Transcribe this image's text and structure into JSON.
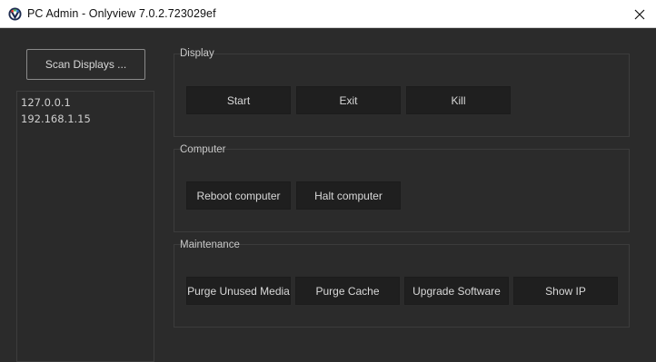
{
  "window": {
    "title": "PC Admin - Onlyview  7.0.2.723029ef",
    "close_icon": "close-icon",
    "app_icon": "onlyview-icon"
  },
  "left_panel": {
    "scan_button": "Scan Displays ...",
    "ip_list": [
      "127.0.0.1",
      "192.168.1.15"
    ]
  },
  "groups": {
    "display": {
      "label": "Display",
      "buttons": [
        "Start",
        "Exit",
        "Kill"
      ]
    },
    "computer": {
      "label": "Computer",
      "buttons": [
        "Reboot computer",
        "Halt computer"
      ]
    },
    "maintenance": {
      "label": "Maintenance",
      "buttons": [
        "Purge Unused Media",
        "Purge Cache",
        "Upgrade Software",
        "Show IP"
      ]
    }
  },
  "colors": {
    "background": "#2b2b2b",
    "button_bg": "#1f1f1f",
    "text": "#d8d8d8",
    "titlebar": "#ffffff"
  }
}
